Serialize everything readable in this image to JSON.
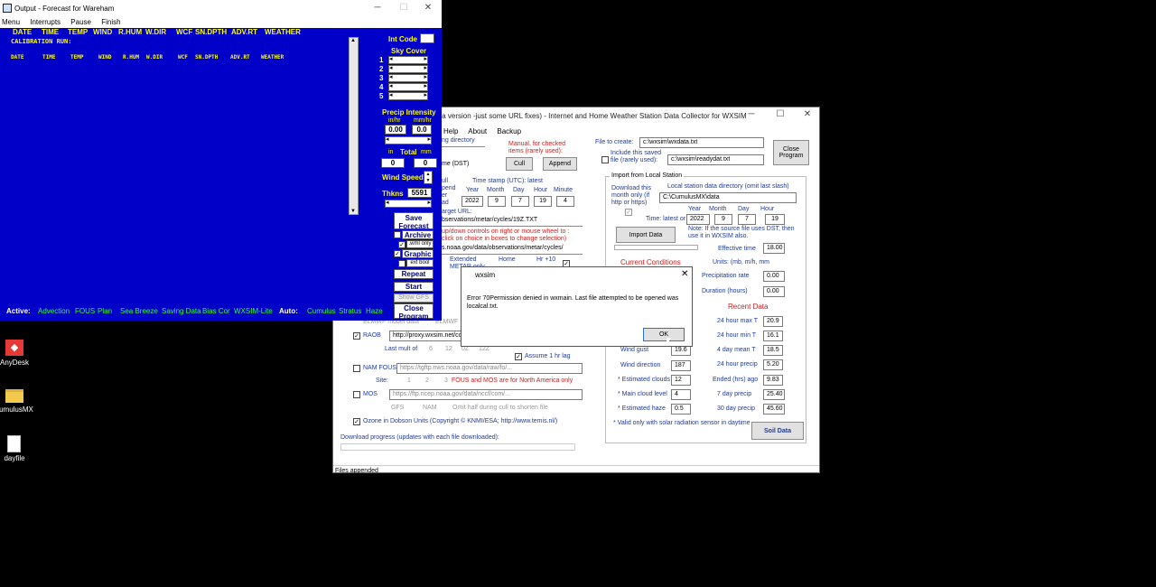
{
  "output_window": {
    "title": "Output - Forecast for Wareham",
    "menu": [
      "Menu",
      "Interrupts",
      "Pause",
      "Finish"
    ],
    "columns": [
      "DATE",
      "TIME",
      "TEMP",
      "WIND",
      "R.HUM",
      "W.DIR",
      "WCF",
      "SN.DPTH",
      "ADV.RT",
      "WEATHER"
    ],
    "calibration_label": "CALIBRATION RUN:",
    "panel": {
      "int_code": "Int Code",
      "sky_cover": "Sky Cover",
      "sky_rows": [
        "1",
        "2",
        "3",
        "4",
        "5"
      ],
      "precip_intensity": "Precip Intensity",
      "in_hr": "in/hr",
      "mm_hr": "mm/hr",
      "in_hr_value": "0.00",
      "mm_hr_value": "0.0",
      "in": "in",
      "total": "Total",
      "mm": "mm",
      "total_in": "0",
      "total_mm": "0",
      "wind_speed": "Wind Speed",
      "thkns": "Thkns",
      "thkns_value": "5591",
      "save_forecast": "Save Forecast",
      "archive": "Archive",
      "wml_only": ".wml only",
      "graphic": "Graphic",
      "ext_bool": "ext bool",
      "repeat": "Repeat",
      "start_fresh": "Start Fresh",
      "show_gfs": "Show GFS",
      "close_program": "Close Program"
    },
    "status": {
      "active": "Active:",
      "items": [
        "Advection",
        "FOUS",
        "Plan",
        "Sea Breeze",
        "Saving Data",
        "Bias Cor",
        "WXSIM-Lite"
      ],
      "auto": "Auto:",
      "auto_items": [
        "Cumulus",
        "Stratus",
        "Haze"
      ]
    }
  },
  "collector_window": {
    "title": "ta version -just some URL fixes)  -  Internet and Home Weather Station Data Collector for WXSIM",
    "menu": [
      "Help",
      "About",
      "Backup"
    ],
    "status_bar": "Files appended",
    "working_directory": "ng directory",
    "time_dst": "me (DST)",
    "manual_note": "Manual, for checked items (rarely used):",
    "cull": "Cull",
    "append": "Append",
    "timestamp_label": "Time stamp (UTC): latest",
    "ts_headers": [
      "Year",
      "Month",
      "Day",
      "Hour",
      "Minute"
    ],
    "ts_values": [
      "2022",
      "9",
      "7",
      "19",
      "4"
    ],
    "left_labels": [
      "ull",
      "pend",
      "er",
      "ad"
    ],
    "target_url_label": "arget URL:",
    "target_url": "bservations/metar/cycles/19Z.TXT",
    "updown_note": "up/down controls on right or mouse wheel to : click on choice in boxes to change selection)",
    "base_url": "s.noaa.gov/data/observations/metar/cycles/",
    "extended": "Extended",
    "metar_only": "METAR only",
    "home": "Home",
    "hr_plus10": "Hr +10",
    "min_only": "min only",
    "file_to_create_label": "File to create:",
    "file_to_create": "c:\\wxsim\\wxdata.txt",
    "include_saved": "Include this saved file (rarely used):",
    "saved_file": "c:\\wxsim\\readydat.txt",
    "close_program": "Close Program",
    "import_group": "Import from Local Station",
    "download_note": "Download this month only (if http or https)",
    "local_dir_label": "Local station data directory (omit last slash)",
    "local_dir": "C:\\CumulusMX\\data",
    "time_latest": "Time: latest or",
    "local_ts_headers": [
      "Year",
      "Month",
      "Day",
      "Hour"
    ],
    "local_ts_values": [
      "2022",
      "9",
      "7",
      "19"
    ],
    "dst_note": "Note: If the source file uses DST, then use it in WXSIM also.",
    "import_data": "Import Data",
    "effective_time_label": "Effective time",
    "effective_time": "18.00",
    "units": "Units: (mb,        m/h,   mm",
    "current_conditions": "Current Conditions",
    "precip_rate_label": "Precipitation rate",
    "precip_rate": "0.00",
    "duration_label": "Duration (hours)",
    "duration": "0.00",
    "recent_data": "Recent Data",
    "max_t_label": "24 hour max T",
    "max_t": "20.9",
    "min_t_label": "24 hour min T",
    "min_t": "16.1",
    "mean_t_label": "4 day mean T",
    "mean_t": "18.5",
    "precip24_label": "24 hour precip",
    "precip24": "5.20",
    "ended_label": "Ended (hrs) ago",
    "ended": "9.83",
    "precip7_label": "7 day precip",
    "precip7": "25.40",
    "precip30_label": "30 day precip",
    "precip30": "45.60",
    "wind_gust_label": "Wind gust",
    "wind_gust": "19.6",
    "wind_dir_label": "Wind direction",
    "wind_dir": "187",
    "est_clouds_label": "* Estimated clouds",
    "est_clouds": "12",
    "main_cloud_label": "* Main cloud level",
    "main_cloud": "4",
    "est_haze_label": "* Estimated haze",
    "est_haze": "0.5",
    "valid_note": "* Valid only with  solar radiation sensor in daytime",
    "soil_data": "Soil Data",
    "elmwf": "ELMWF model data",
    "elmwf2": "ELMWF",
    "raob": "RAOB",
    "raob_url": "http://proxy.wxsim.net/co",
    "last_mult": "Last mult of",
    "raob_options": [
      "6",
      "12",
      "0Z",
      "12Z"
    ],
    "assume_lag": "Assume 1 hr lag",
    "nam_fous": "NAM FOUS",
    "nam_url": "https://tgftp.nws.noaa.gov/data/raw/fo/...",
    "site": "Site:",
    "sites": [
      "1",
      "2",
      "3"
    ],
    "fous_note": "FOUS and MOS are for North America only",
    "mos": "MOS",
    "mos_url": "https://ftp.ncep.noaa.gov/data/nccf/com/...",
    "gfs": "GFS",
    "nam": "NAM",
    "omit_half": "Omit half during cull to shorten file",
    "ozone": "Ozone  in Dobson Units (Copyright © KNMI/ESA; http://www.temis.nl/)",
    "download_progress": "Download progress (updates with each file downloaded):"
  },
  "dialog": {
    "title": "wxsim",
    "message": "Error 70Permission denied in wxmain.  Last file attempted to be opened was localcal.txt.",
    "ok": "OK"
  },
  "desktop_icons": [
    {
      "label": "AnyDesk"
    },
    {
      "label": "umulusMX"
    },
    {
      "label": "dayfile"
    }
  ],
  "colors": {
    "output_bg": "#0000c8",
    "column_header": "#ffff00",
    "status_green": "#2dff2d",
    "red_text": "#d11b1b"
  }
}
